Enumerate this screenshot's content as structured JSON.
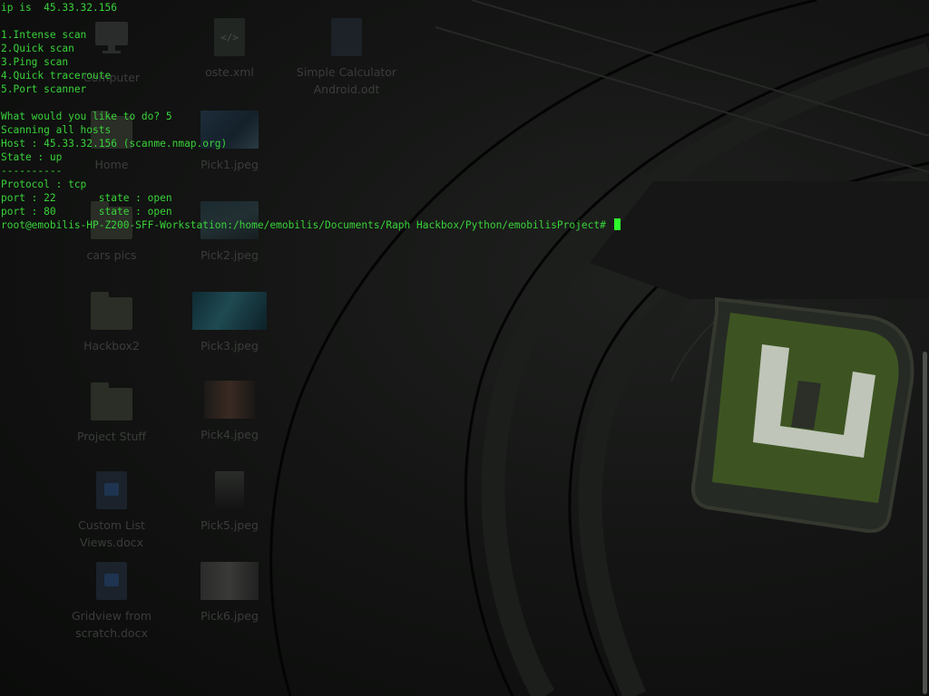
{
  "desktop": {
    "icons": [
      {
        "label": "Computer",
        "icon": "computer-icon"
      },
      {
        "label": "oste.xml",
        "icon": "xml-file-icon"
      },
      {
        "label": "Simple Calculator Android.odt",
        "icon": "document-icon"
      },
      {
        "label": "Home",
        "icon": "home-folder-icon"
      },
      {
        "label": "Pick1.jpeg",
        "icon": "image-thumbnail"
      },
      {
        "label": "cars pics",
        "icon": "folder-icon"
      },
      {
        "label": "Pick2.jpeg",
        "icon": "image-thumbnail"
      },
      {
        "label": "Hackbox2",
        "icon": "folder-icon"
      },
      {
        "label": "Pick3.jpeg",
        "icon": "image-thumbnail"
      },
      {
        "label": "Project Stuff",
        "icon": "folder-icon"
      },
      {
        "label": "Pick4.jpeg",
        "icon": "image-thumbnail"
      },
      {
        "label": "Custom List Views.docx",
        "icon": "word-document-icon"
      },
      {
        "label": "Pick5.jpeg",
        "icon": "image-thumbnail"
      },
      {
        "label": "Gridview from scratch.docx",
        "icon": "word-document-icon"
      },
      {
        "label": "Pick6.jpeg",
        "icon": "image-thumbnail"
      }
    ]
  },
  "terminal": {
    "lines": [
      "ip is  45.33.32.156",
      "",
      "1.Intense scan",
      "2.Quick scan",
      "3.Ping scan",
      "4.Quick traceroute",
      "5.Port scanner",
      "",
      "What would you like to do? 5",
      "Scanning all hosts",
      "Host : 45.33.32.156 (scanme.nmap.org)",
      "State : up",
      "----------",
      "Protocol : tcp",
      "port : 22       state : open",
      "port : 80       state : open"
    ],
    "prompt": "root@emobilis-HP-Z200-SFF-Workstation:/home/emobilis/Documents/Raph Hackbox/Python/emobilisProject# "
  },
  "colors": {
    "terminal_text": "#39d23a",
    "cursor": "#2cff2c",
    "wallpaper_logo": "#4e6b2c"
  }
}
